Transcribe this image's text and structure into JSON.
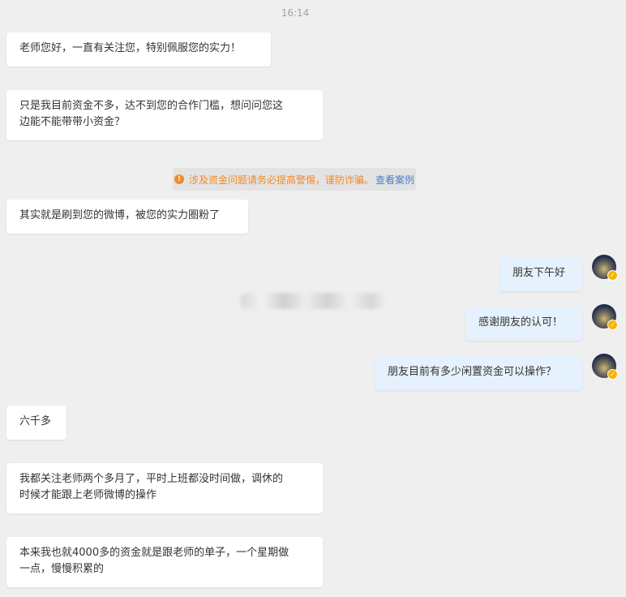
{
  "timestamp": "16:14",
  "messages": [
    {
      "side": "in",
      "text": "老师您好，一直有关注您，特别佩服您的实力！"
    },
    {
      "side": "in",
      "text_line1": "只是我目前资金不多，达不到您的合作门槛，想问问您这",
      "text_line2": "边能不能带带小资金？"
    },
    {
      "side": "in",
      "text": "其实就是刷到您的微博，被您的实力圈粉了"
    },
    {
      "side": "out",
      "text": "朋友下午好"
    },
    {
      "side": "out",
      "text": "感谢朋友的认可！"
    },
    {
      "side": "out",
      "text": "朋友目前有多少闲置资金可以操作？"
    },
    {
      "side": "in",
      "text": "六千多"
    },
    {
      "side": "in",
      "text_line1": "我都关注老师两个多月了，平时上班都没时间做，调休的",
      "text_line2": "时候才能跟上老师微博的操作"
    },
    {
      "side": "in",
      "text_line1": "本来我也就4000多的资金就是跟老师的单子，一个星期做",
      "text_line2": "一点，慢慢积累的"
    }
  ],
  "notice": {
    "icon": "warning-icon",
    "icon_glyph": "!",
    "text": "涉及资金问题请务必提高警惕，谨防诈骗。",
    "link": "查看案例",
    "color": "#f08a2a",
    "link_color": "#4a7fc4"
  },
  "avatar": {
    "icon": "user-avatar",
    "badge_icon": "verified-badge-icon",
    "badge_glyph": "✓"
  },
  "colors": {
    "background": "#efefef",
    "incoming_bubble": "#ffffff",
    "outgoing_bubble": "#e5f1fc"
  }
}
